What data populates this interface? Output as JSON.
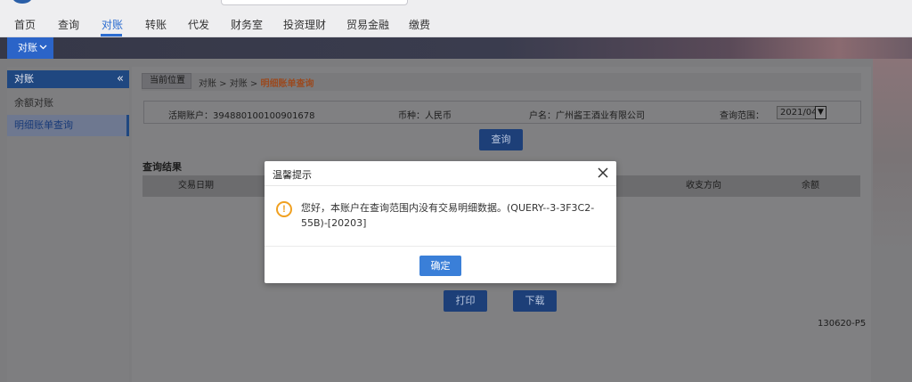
{
  "topnav": {
    "items": [
      "首页",
      "查询",
      "对账",
      "转账",
      "代发",
      "财务室",
      "投资理财",
      "贸易金融",
      "缴费"
    ],
    "active_index": 2
  },
  "subbar": {
    "tab_label": "对账",
    "chevron_icon": "chevron-down-icon"
  },
  "sidebar": {
    "header": "对账",
    "collapse_icon": "double-chevron-left-icon",
    "items": [
      "余额对账",
      "明细账单查询"
    ],
    "active_index": 1
  },
  "breadcrumb": {
    "tag": "当前位置",
    "path": "对账 > 对账 > ",
    "current": "明细账单查询"
  },
  "info": {
    "account_label": "活期账户：",
    "account_value": "394880100100901678",
    "currency_label": "币种：",
    "currency_value": "人民币",
    "name_label": "户名：",
    "name_value": "广州酱王酒业有限公司",
    "range_label": "查询范围：",
    "range_value": "2021/04"
  },
  "query_button": "查询",
  "results": {
    "title": "查询结果",
    "columns": [
      "交易日期",
      "收支方向",
      "余额"
    ]
  },
  "print_button": "打印",
  "download_button": "下载",
  "footer_code": "130620-P5",
  "modal": {
    "title": "温馨提示",
    "close_icon": "close-icon",
    "warning_icon": "warning-icon",
    "message": "您好，本账户在查询范围内没有交易明细数据。(QUERY--3-3F3C2-55B)-[20203]",
    "ok_button": "确定"
  },
  "colors": {
    "accent": "#2b6cd0",
    "button_blue": "#3a7fd8",
    "warning": "#f0a020",
    "sidebar_head": "#1f4780"
  }
}
